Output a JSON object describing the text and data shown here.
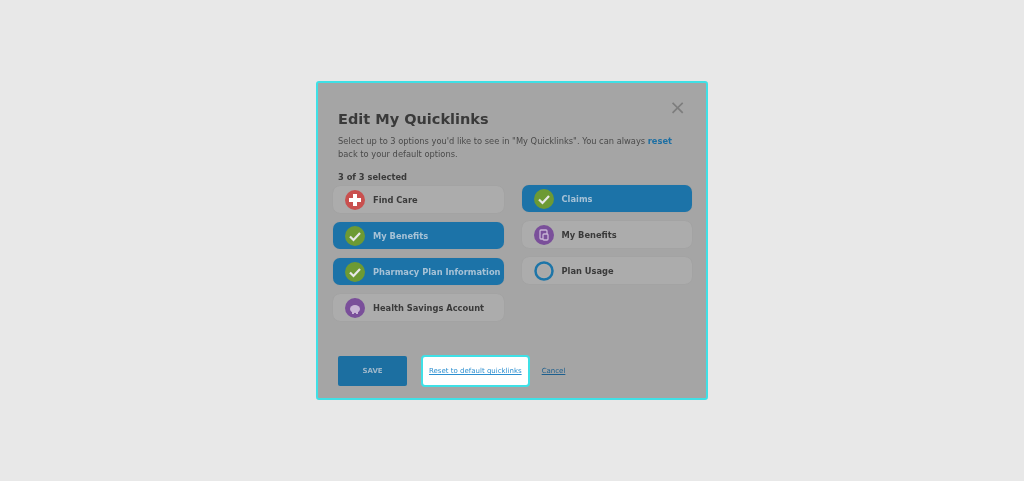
{
  "dialog": {
    "title": "Edit My Quicklinks",
    "close": "×",
    "description": "Select up to 3 options you'd like to see in \"My Quicklinks\". You can always **reset** back to your default options.",
    "count": "3 of 3 selected"
  },
  "columns": [
    [
      {
        "label": "Find Care",
        "kind": "plus",
        "selected": false
      },
      {
        "label": "My Benefits",
        "kind": "check",
        "selected": true
      },
      {
        "label": "Pharmacy Plan Information",
        "kind": "check",
        "selected": true
      },
      {
        "label": "Health Savings Account",
        "kind": "piggy",
        "selected": false
      }
    ],
    [
      {
        "label": "Claims",
        "kind": "check",
        "selected": true
      },
      {
        "label": "My Benefits",
        "kind": "document",
        "selected": false
      },
      {
        "label": "Plan Usage",
        "kind": "ring",
        "selected": false
      }
    ]
  ],
  "actions": {
    "save": "SAVE",
    "reset": {
      "label": "Reset to default quicklinks",
      "focused": true
    },
    "cancel": "Cancel"
  }
}
